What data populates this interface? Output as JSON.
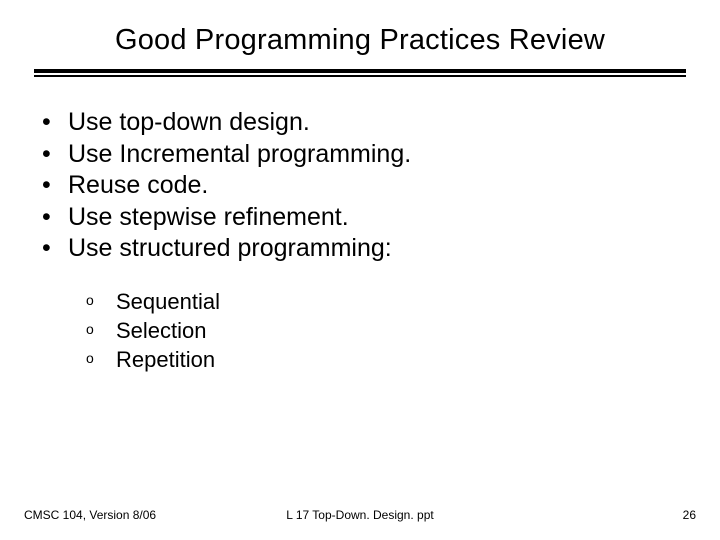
{
  "title": "Good Programming Practices Review",
  "bullets": [
    "Use top-down design.",
    "Use Incremental programming.",
    "Reuse code.",
    "Use stepwise refinement.",
    "Use structured programming:"
  ],
  "sub_bullets": [
    "Sequential",
    "Selection",
    "Repetition"
  ],
  "footer": {
    "left": "CMSC 104, Version 8/06",
    "center": "L 17 Top-Down. Design. ppt",
    "right": "26"
  }
}
